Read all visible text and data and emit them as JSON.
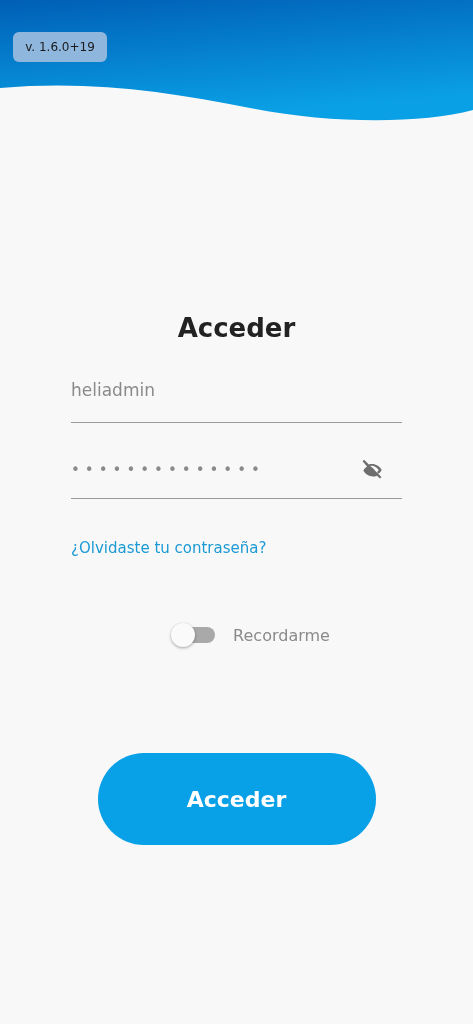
{
  "version_badge": "v. 1.6.0+19",
  "title": "Acceder",
  "username": {
    "value": "heliadmin"
  },
  "password": {
    "value": "••••••••••••••",
    "visible": false
  },
  "forgot_link": "¿Olvidaste tu contraseña?",
  "remember": {
    "label": "Recordarme",
    "on": false
  },
  "submit_button": "Acceder"
}
